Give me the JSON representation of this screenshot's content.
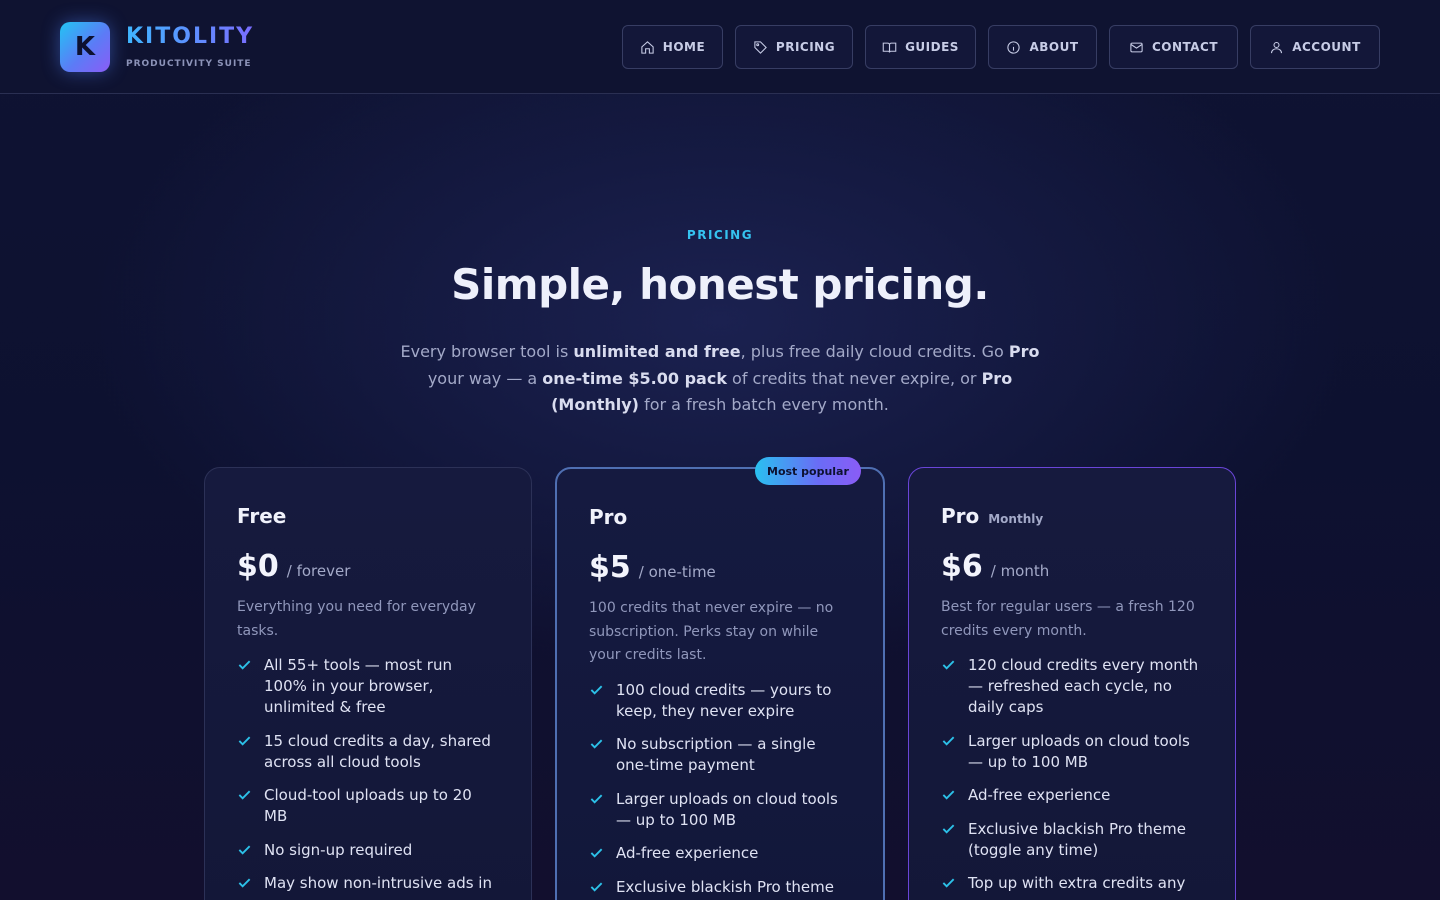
{
  "brand": {
    "initial": "K",
    "name": "KITOLITY",
    "tagline": "PRODUCTIVITY SUITE"
  },
  "nav": [
    {
      "label": "HOME",
      "icon": "home-icon"
    },
    {
      "label": "PRICING",
      "icon": "tag-icon"
    },
    {
      "label": "GUIDES",
      "icon": "book-icon"
    },
    {
      "label": "ABOUT",
      "icon": "info-icon"
    },
    {
      "label": "CONTACT",
      "icon": "mail-icon"
    },
    {
      "label": "ACCOUNT",
      "icon": "user-icon"
    }
  ],
  "hero": {
    "eyebrow": "PRICING",
    "headline": "Simple, honest pricing.",
    "lead_parts": [
      "Every browser tool is ",
      "unlimited and free",
      ", plus free daily cloud credits. Go ",
      "Pro",
      " your way — a ",
      "one-time $5.00 pack",
      " of credits that never expire, or ",
      "Pro (Monthly)",
      " for a fresh batch every month."
    ]
  },
  "plans": {
    "free": {
      "name": "Free",
      "price": "$0",
      "period": "/ forever",
      "description": "Everything you need for everyday tasks.",
      "features": [
        "All 55+ tools — most run 100% in your browser, unlimited & free",
        "15 cloud credits a day, shared across all cloud tools",
        "Cloud-tool uploads up to 20 MB",
        "No sign-up required",
        "May show non-intrusive ads in"
      ]
    },
    "pro": {
      "badge": "Most popular",
      "name": "Pro",
      "price": "$5",
      "period": "/ one-time",
      "description": "100 credits that never expire — no subscription. Perks stay on while your credits last.",
      "features": [
        "100 cloud credits — yours to keep, they never expire",
        "No subscription — a single one-time payment",
        "Larger uploads on cloud tools — up to 100 MB",
        "Ad-free experience",
        "Exclusive blackish Pro theme"
      ]
    },
    "monthly": {
      "name": "Pro",
      "name_suffix": "Monthly",
      "price": "$6",
      "period": "/ month",
      "description": "Best for regular users — a fresh 120 credits every month.",
      "features": [
        "120 cloud credits every month — refreshed each cycle, no daily caps",
        "Larger uploads on cloud tools — up to 100 MB",
        "Ad-free experience",
        "Exclusive blackish Pro theme (toggle any time)",
        "Top up with extra credits any"
      ]
    }
  },
  "colors": {
    "accent_cyan": "#2cc1e8",
    "accent_violet": "#8a5cf6",
    "background": "#0f1333"
  }
}
